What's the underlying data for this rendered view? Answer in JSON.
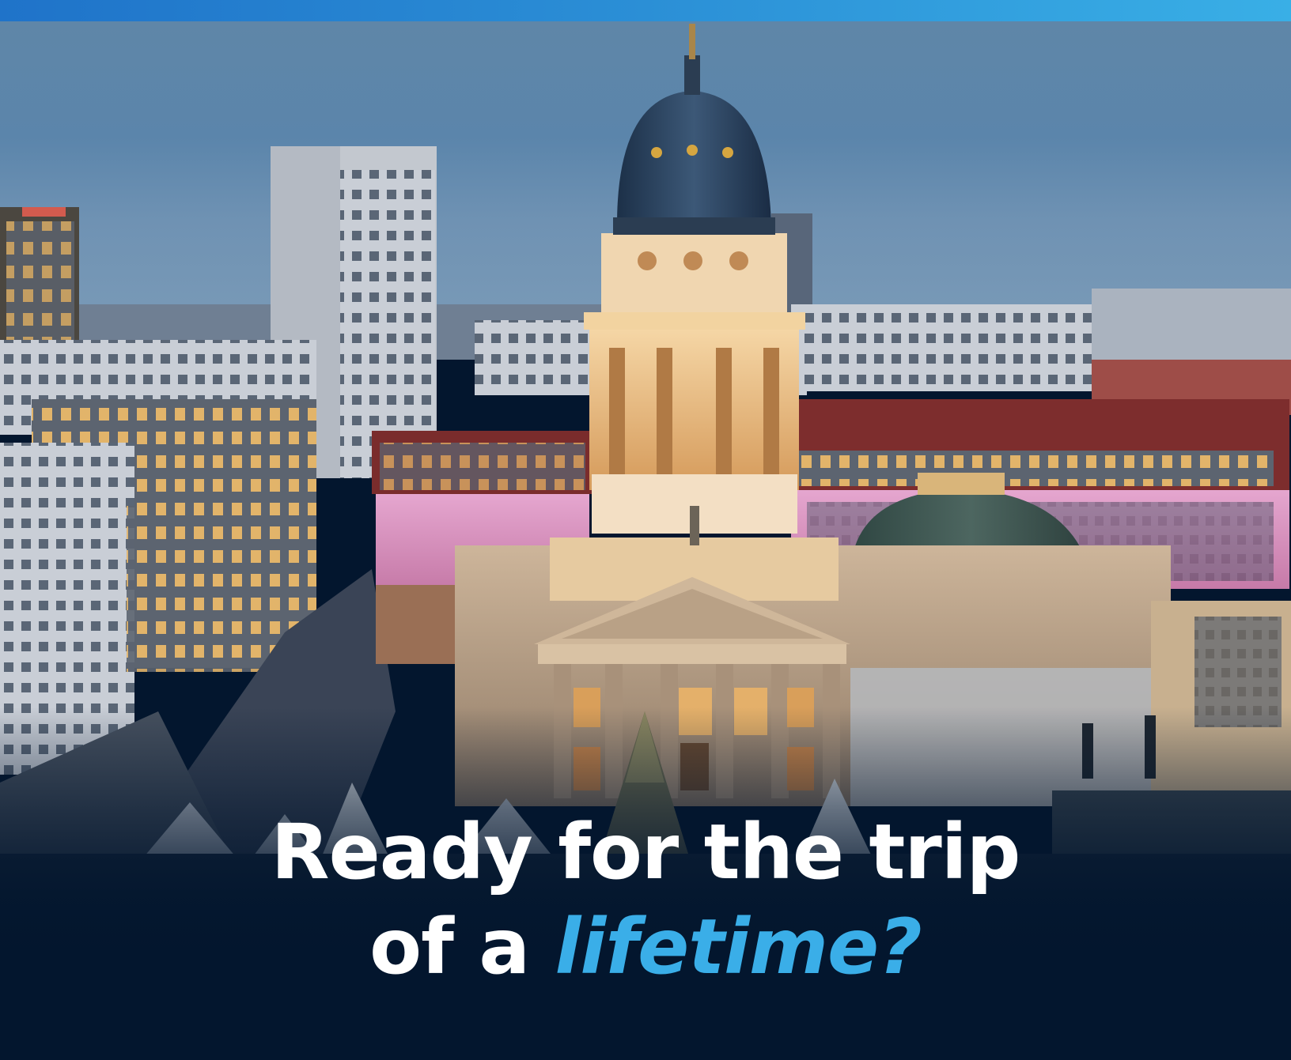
{
  "headline": {
    "line1": "Ready for the trip",
    "line2_prefix": "of a ",
    "line2_accent": "lifetime?"
  },
  "photo": {
    "subject": "city-dome-cathedral-dusk"
  },
  "colors": {
    "accent": "#3aaee8",
    "background": "#03162e",
    "top_bar_start": "#1f73c9",
    "top_bar_end": "#39afe6",
    "headline_text": "#ffffff"
  }
}
